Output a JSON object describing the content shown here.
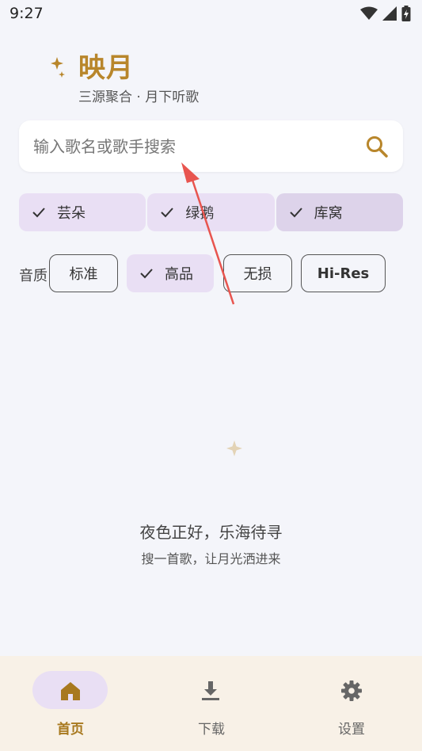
{
  "status": {
    "time": "9:27"
  },
  "header": {
    "title": "映月",
    "subtitle": "三源聚合 · 月下听歌",
    "logo_icon": "moon-star-icon",
    "brand_color": "#b8862b"
  },
  "search": {
    "placeholder": "输入歌名或歌手搜索",
    "value": ""
  },
  "sources": [
    {
      "label": "芸朵",
      "checked": true
    },
    {
      "label": "绿鹅",
      "checked": true
    },
    {
      "label": "库窝",
      "checked": true
    }
  ],
  "quality": {
    "label": "音质",
    "options": [
      {
        "label": "标准",
        "selected": false
      },
      {
        "label": "高品",
        "selected": true
      },
      {
        "label": "无损",
        "selected": false
      },
      {
        "label": "Hi-Res",
        "selected": false
      }
    ]
  },
  "empty_state": {
    "title": "夜色正好，乐海待寻",
    "subtitle": "搜一首歌，让月光洒进来"
  },
  "nav": {
    "items": [
      {
        "label": "首页",
        "icon": "home-icon",
        "active": true
      },
      {
        "label": "下载",
        "icon": "download-icon",
        "active": false
      },
      {
        "label": "设置",
        "icon": "gear-icon",
        "active": false
      }
    ]
  },
  "colors": {
    "accent": "#b8862b",
    "chip_bg": "#e9dff4",
    "nav_bg": "#f8f1e7",
    "annotation": "#e8554f"
  }
}
